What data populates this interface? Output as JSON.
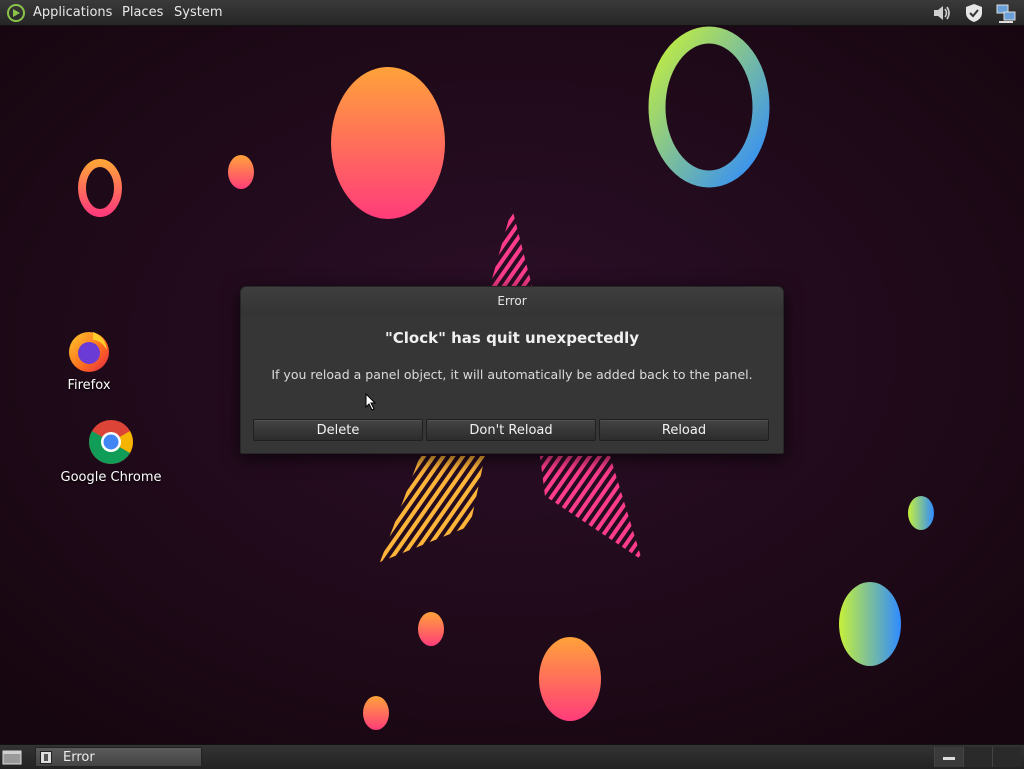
{
  "top_panel": {
    "menus": {
      "applications": "Applications",
      "places": "Places",
      "system": "System"
    },
    "tray_icons": [
      "volume-icon",
      "shield-icon",
      "network-icon"
    ]
  },
  "desktop": {
    "icons": [
      {
        "label": "Firefox",
        "icon": "firefox-icon"
      },
      {
        "label": "Google Chrome",
        "icon": "chrome-icon"
      }
    ]
  },
  "dialog": {
    "title": "Error",
    "heading": "\"Clock\" has quit unexpectedly",
    "message": "If you reload a panel object, it will automatically be added back to the panel.",
    "buttons": {
      "delete": "Delete",
      "dont_reload": "Don't Reload",
      "reload": "Reload"
    }
  },
  "bottom_panel": {
    "tasks": [
      {
        "label": "Error",
        "icon": "window-icon"
      }
    ],
    "workspaces": 3
  },
  "colors": {
    "background": "#1f0a1d",
    "panel": "#2e2e2e",
    "dialog": "#363636",
    "accent_orange": "#ff8c3a",
    "accent_pink": "#ff3c8c",
    "accent_green": "#b8f04a",
    "accent_blue": "#3aa0ff"
  }
}
